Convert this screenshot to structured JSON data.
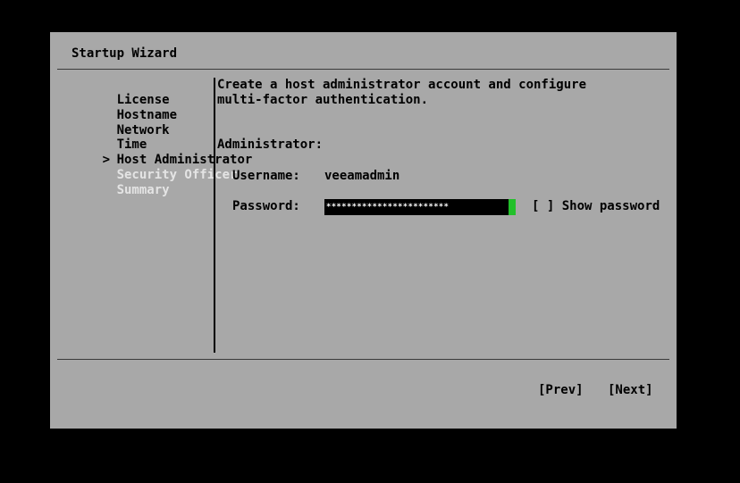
{
  "wizard": {
    "title": "Startup Wizard",
    "steps": [
      {
        "label": "License",
        "state": "done",
        "marker": ""
      },
      {
        "label": "Hostname",
        "state": "done",
        "marker": ""
      },
      {
        "label": "Network",
        "state": "done",
        "marker": ""
      },
      {
        "label": "Time",
        "state": "done",
        "marker": ""
      },
      {
        "label": "Host Administrator",
        "state": "current",
        "marker": ">"
      },
      {
        "label": "Security Officer",
        "state": "pending",
        "marker": ""
      },
      {
        "label": "Summary",
        "state": "pending",
        "marker": ""
      }
    ]
  },
  "content": {
    "description_line1": "Create a host administrator account and configure",
    "description_line2": "multi-factor authentication.",
    "section_label": "Administrator:",
    "username_label": "Username:",
    "username_value": "veeamadmin",
    "password_label": "Password:",
    "password_mask": "************************",
    "show_password_checkbox": "[ ]",
    "show_password_label": "Show password"
  },
  "buttons": {
    "prev": "[Prev]",
    "next": "[Next]"
  },
  "colors": {
    "screen_background": "#000000",
    "dialog_background": "#a8a8a8",
    "text": "#000000",
    "disabled_text": "#e4e4e4",
    "input_background": "#000000",
    "input_text": "#ffffff",
    "cursor": "#22c02a"
  }
}
